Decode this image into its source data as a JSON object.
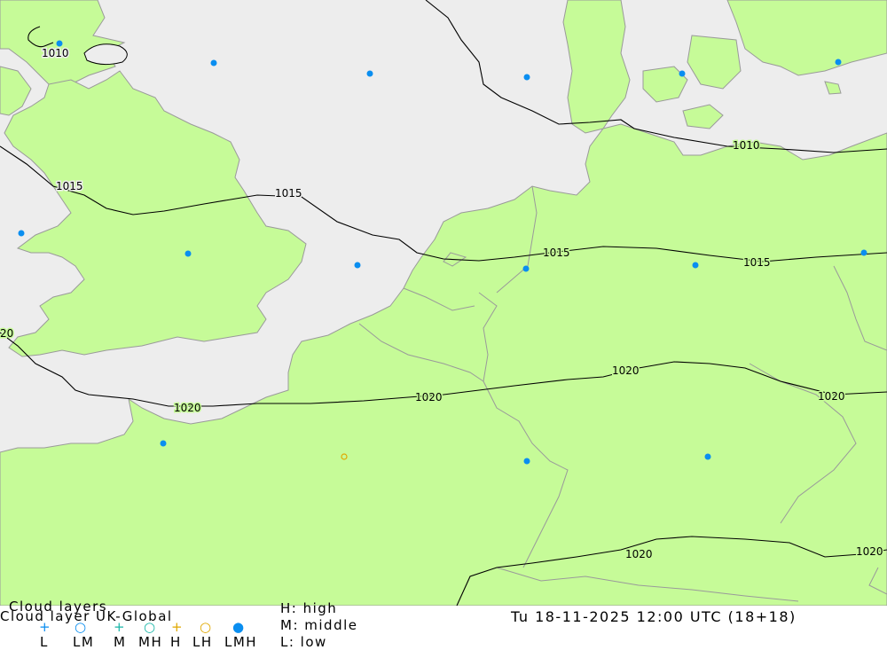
{
  "map": {
    "colors": {
      "sea": "#ededed",
      "land": "#c6fb98",
      "coast": "#9a9a9a",
      "isobar": "#000000",
      "station": "#0a8ef0",
      "mid_high": "#e0a800"
    },
    "isobar_labels": [
      "1010",
      "1010",
      "1015",
      "1015",
      "1015",
      "1015",
      "20",
      "1020",
      "1020",
      "1020",
      "1020",
      "1020",
      "1020"
    ]
  },
  "footer": {
    "title_line1": "Cloud layers",
    "title_line2": "Cloud layer  UK-Global",
    "legend_symbols": [
      {
        "symbol": "+",
        "label": "L",
        "color": "#0a8ef0"
      },
      {
        "symbol": "○",
        "label": "LM",
        "color": "#0a8ef0"
      },
      {
        "symbol": "+",
        "label": "M",
        "color": "#19b6a8"
      },
      {
        "symbol": "○",
        "label": "MH",
        "color": "#19b6a8"
      },
      {
        "symbol": "+",
        "label": "H",
        "color": "#e0a800"
      },
      {
        "symbol": "○",
        "label": "LH",
        "color": "#e0a800"
      },
      {
        "symbol": "●",
        "label": "LMH",
        "color": "#0a8ef0"
      }
    ],
    "key_high": "H: high",
    "key_middle": "M: middle",
    "key_low": "L: low",
    "datetime": "Tu 18-11-2025 12:00 UTC (18+18)"
  }
}
